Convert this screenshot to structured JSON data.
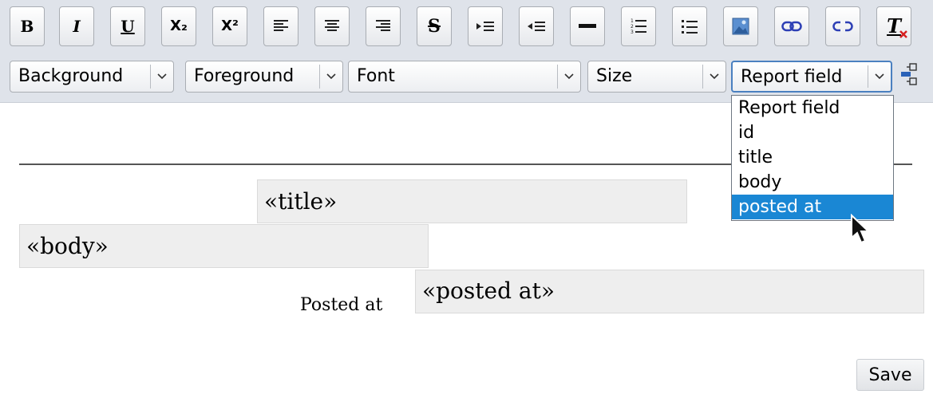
{
  "toolbar": {
    "buttons": [
      {
        "name": "bold",
        "icon": "bold-icon",
        "glyph": "B"
      },
      {
        "name": "italic",
        "icon": "italic-icon",
        "glyph": "I"
      },
      {
        "name": "underline",
        "icon": "underline-icon",
        "glyph": "U"
      },
      {
        "name": "subscript",
        "icon": "subscript-icon",
        "glyph": "X₂"
      },
      {
        "name": "superscript",
        "icon": "superscript-icon",
        "glyph": "X²"
      },
      {
        "name": "align-left",
        "icon": "align-left-icon"
      },
      {
        "name": "align-center",
        "icon": "align-center-icon"
      },
      {
        "name": "align-right",
        "icon": "align-right-icon"
      },
      {
        "name": "strikethrough",
        "icon": "strikethrough-icon",
        "glyph": "S"
      },
      {
        "name": "indent",
        "icon": "indent-icon"
      },
      {
        "name": "outdent",
        "icon": "outdent-icon"
      },
      {
        "name": "horizontal-rule",
        "icon": "horizontal-rule-icon"
      },
      {
        "name": "ordered-list",
        "icon": "ordered-list-icon"
      },
      {
        "name": "unordered-list",
        "icon": "unordered-list-icon"
      },
      {
        "name": "insert-image",
        "icon": "image-icon"
      },
      {
        "name": "link",
        "icon": "link-icon"
      },
      {
        "name": "unlink",
        "icon": "unlink-icon"
      },
      {
        "name": "remove-format",
        "icon": "remove-format-icon",
        "glyph": "T"
      }
    ],
    "selects": {
      "background": "Background",
      "foreground": "Foreground",
      "font": "Font",
      "size": "Size",
      "report_field": "Report field"
    }
  },
  "dropdown": {
    "options": [
      "Report field",
      "id",
      "title",
      "body",
      "posted at"
    ],
    "highlighted": "posted at"
  },
  "document": {
    "title_field": "«title»",
    "body_field": "«body»",
    "posted_label": "Posted at",
    "posted_field": "«posted at»"
  },
  "actions": {
    "save_label": "Save"
  },
  "colors": {
    "toolbar_bg": "#dfe3ea",
    "highlight": "#1a87d4",
    "field_bg": "#eeeeee"
  }
}
